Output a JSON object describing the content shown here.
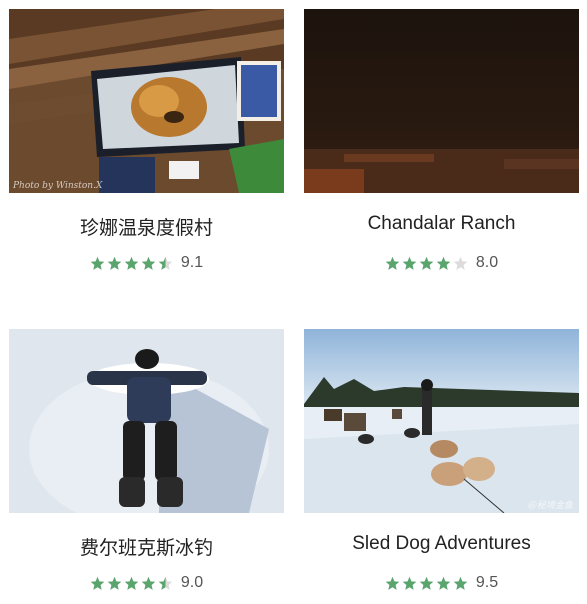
{
  "colors": {
    "star_on": "#5aa46e",
    "star_off": "#dcdcdc"
  },
  "cards": [
    {
      "title": "珍娜温泉度假村",
      "stars": [
        1,
        1,
        1,
        1,
        0.5
      ],
      "score": "9.1",
      "photo_alt": "bear painting in log cabin",
      "watermark": "Photo by Winston.X"
    },
    {
      "title": "Chandalar Ranch",
      "stars": [
        1,
        1,
        1,
        1,
        0
      ],
      "score": "8.0",
      "photo_alt": "dark night over snowy ranch",
      "watermark": ""
    },
    {
      "title": "费尔班克斯冰钓",
      "stars": [
        1,
        1,
        1,
        1,
        0.5
      ],
      "score": "9.0",
      "photo_alt": "person making snow angel",
      "watermark": ""
    },
    {
      "title": "Sled Dog Adventures",
      "stars": [
        1,
        1,
        1,
        1,
        1
      ],
      "score": "9.5",
      "photo_alt": "sled dogs on snow",
      "watermark": "@秘境金鱼"
    }
  ]
}
